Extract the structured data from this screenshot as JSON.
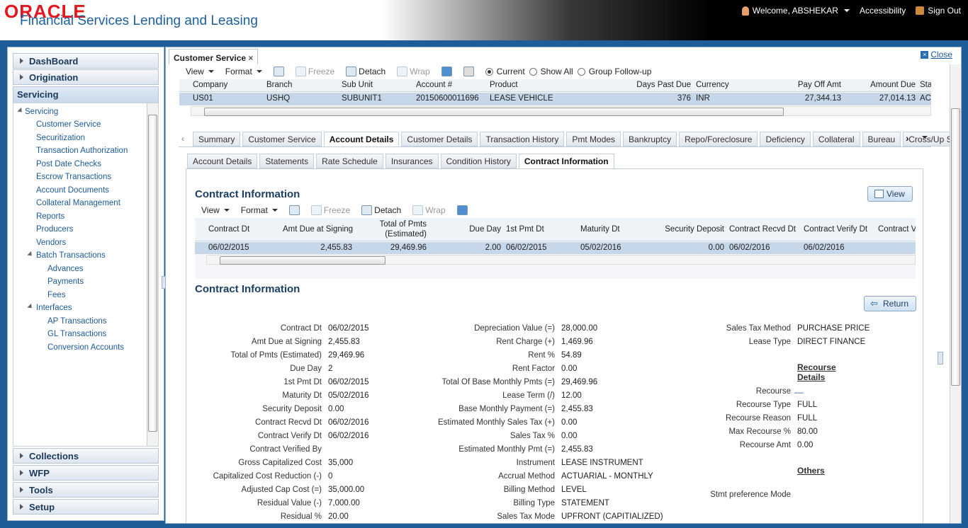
{
  "header": {
    "oracle": "ORACLE",
    "app_title": "Financial Services Lending and Leasing",
    "welcome": "Welcome, ABSHEKAR",
    "accessibility": "Accessibility",
    "signout": "Sign Out"
  },
  "nav": {
    "dashboard": "DashBoard",
    "origination": "Origination",
    "servicing": "Servicing",
    "collections": "Collections",
    "wfp": "WFP",
    "tools": "Tools",
    "setup": "Setup"
  },
  "tree": [
    "Servicing",
    "Customer Service",
    "Securitization",
    "Transaction Authorization",
    "Post Date Checks",
    "Escrow Transactions",
    "Account Documents",
    "Collateral Management",
    "Reports",
    "Producers",
    "Vendors",
    "Batch Transactions",
    "Advances",
    "Payments",
    "Fees",
    "Interfaces",
    "AP Transactions",
    "GL Transactions",
    "Conversion Accounts"
  ],
  "close": "Close",
  "page_tab": "Customer Service",
  "toolbar": {
    "view": "View",
    "format": "Format",
    "freeze": "Freeze",
    "detach": "Detach",
    "wrap": "Wrap",
    "current": "Current",
    "show_all": "Show All",
    "group_followup": "Group Follow-up"
  },
  "account_grid": {
    "headers": [
      "Company",
      "Branch",
      "Sub Unit",
      "Account #",
      "Product",
      "Days Past Due",
      "Currency",
      "Pay Off Amt",
      "Amount Due",
      "Sta"
    ],
    "row": [
      "US01",
      "USHQ",
      "SUBUNIT1",
      "20150600011696",
      "LEASE VEHICLE",
      "376",
      "INR",
      "27,344.13",
      "27,014.13",
      "ACT"
    ]
  },
  "main_tabs": [
    "Summary",
    "Customer Service",
    "Account Details",
    "Customer Details",
    "Transaction History",
    "Pmt Modes",
    "Bankruptcy",
    "Repo/Foreclosure",
    "Deficiency",
    "Collateral",
    "Bureau",
    "Cross/Up Sell Activit"
  ],
  "sub_tabs": [
    "Account Details",
    "Statements",
    "Rate Schedule",
    "Insurances",
    "Condition History",
    "Contract Information"
  ],
  "contract_section": {
    "title": "Contract Information",
    "view_btn": "View",
    "return_btn": "Return"
  },
  "contract_grid": {
    "headers": [
      "Contract Dt",
      "Amt Due at Signing",
      "Total of Pmts (Estimated)",
      "Due Day",
      "1st Pmt Dt",
      "Maturity Dt",
      "Security Deposit",
      "Contract Recvd Dt",
      "Contract Verify Dt",
      "Contract Ve"
    ],
    "row": [
      "06/02/2015",
      "2,455.83",
      "29,469.96",
      "2.00",
      "06/02/2015",
      "05/02/2016",
      "0.00",
      "06/02/2016",
      "06/02/2016",
      ""
    ]
  },
  "form_col1": [
    [
      "Contract Dt",
      "06/02/2015"
    ],
    [
      "Amt Due at Signing",
      "2,455.83"
    ],
    [
      "Total of Pmts (Estimated)",
      "29,469.96"
    ],
    [
      "Due Day",
      "2"
    ],
    [
      "1st Pmt Dt",
      "06/02/2015"
    ],
    [
      "Maturity Dt",
      "05/02/2016"
    ],
    [
      "Security Deposit",
      "0.00"
    ],
    [
      "Contract Recvd Dt",
      "06/02/2016"
    ],
    [
      "Contract Verify Dt",
      "06/02/2016"
    ],
    [
      "Contract Verified By",
      ""
    ],
    [
      "Gross Capitalized Cost",
      "35,000"
    ],
    [
      "Capitalized Cost Reduction (-)",
      "0"
    ],
    [
      "Adjusted Cap Cost (=)",
      "35,000.00"
    ],
    [
      "Residual Value (-)",
      "7,000.00"
    ],
    [
      "Residual %",
      "20.00"
    ]
  ],
  "form_col2": [
    [
      "Depreciation Value (=)",
      "28,000.00"
    ],
    [
      "Rent Charge (+)",
      "1,469.96"
    ],
    [
      "Rent %",
      "54.89"
    ],
    [
      "Rent Factor",
      "0.00"
    ],
    [
      "Total Of Base Monthly Pmts (=)",
      "29,469.96"
    ],
    [
      "Lease Term (/)",
      "12.00"
    ],
    [
      "Base Monthly Payment (=)",
      "2,455.83"
    ],
    [
      "Estimated Monthly Sales Tax (+)",
      "0.00"
    ],
    [
      "Sales Tax %",
      "0.00"
    ],
    [
      "Estimated Monthly Pmt (=)",
      "2,455.83"
    ],
    [
      "Instrument",
      "LEASE INSTRUMENT"
    ],
    [
      "Accrual Method",
      "ACTUARIAL - MONTHLY"
    ],
    [
      "Billing Method",
      "LEVEL"
    ],
    [
      "Billing Type",
      "STATEMENT"
    ],
    [
      "Sales Tax Mode",
      "UPFRONT (CAPITIALIZED)"
    ]
  ],
  "form_col3": {
    "sales_tax_method_label": "Sales Tax Method",
    "sales_tax_method": "PURCHASE PRICE",
    "lease_type_label": "Lease Type",
    "lease_type": "DIRECT FINANCE",
    "recourse_details": "Recourse Details",
    "recourse_label": "Recourse",
    "recourse": "__",
    "recourse_type_label": "Recourse Type",
    "recourse_type": "FULL",
    "recourse_reason_label": "Recourse Reason",
    "recourse_reason": "FULL",
    "max_recourse_label": "Max Recourse %",
    "max_recourse": "80.00",
    "recourse_amt_label": "Recourse Amt",
    "recourse_amt": "0.00",
    "others": "Others",
    "stmt_pref_label": "Stmt preference Mode"
  }
}
